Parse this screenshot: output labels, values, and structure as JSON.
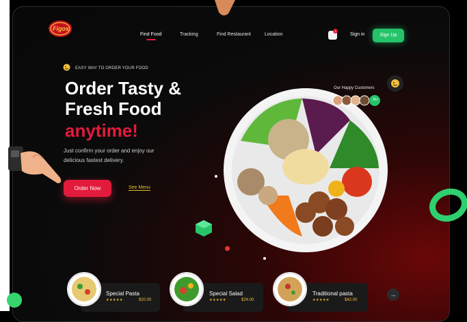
{
  "brand": {
    "logo_text": "Figos"
  },
  "nav": {
    "items": [
      "Find Food",
      "Tracking",
      "Find Restaurant",
      "Location"
    ],
    "active": "Find Food"
  },
  "cart": {
    "count": "1"
  },
  "auth": {
    "signin_label": "Sign in",
    "signup_label": "Sign Up"
  },
  "hero": {
    "tagline": "EASY WAY TO ORDER YOUR FOOD",
    "title_line1": "Order Tasty &",
    "title_line2": "Fresh Food",
    "title_line3": "anytime!",
    "subtitle_line1": "Just confirm your order and enjoy our",
    "subtitle_line2": "delicious fastest delivery.",
    "order_button": "Order Now",
    "see_menu": "See Menu"
  },
  "customers": {
    "label": "Our Happy Customers",
    "more": "2k+"
  },
  "dishes": [
    {
      "name": "Special Pasta",
      "rating": "★★★★★",
      "price": "$20.00"
    },
    {
      "name": "Special Salad",
      "rating": "★★★★★",
      "price": "$24.00"
    },
    {
      "name": "Traditional pasta",
      "rating": "★★★★★",
      "price": "$42.00"
    }
  ],
  "carousel": {
    "next_icon": "→"
  },
  "colors": {
    "accent_red": "#e21b3c",
    "accent_green": "#25c36a",
    "accent_yellow": "#e8c12e"
  }
}
